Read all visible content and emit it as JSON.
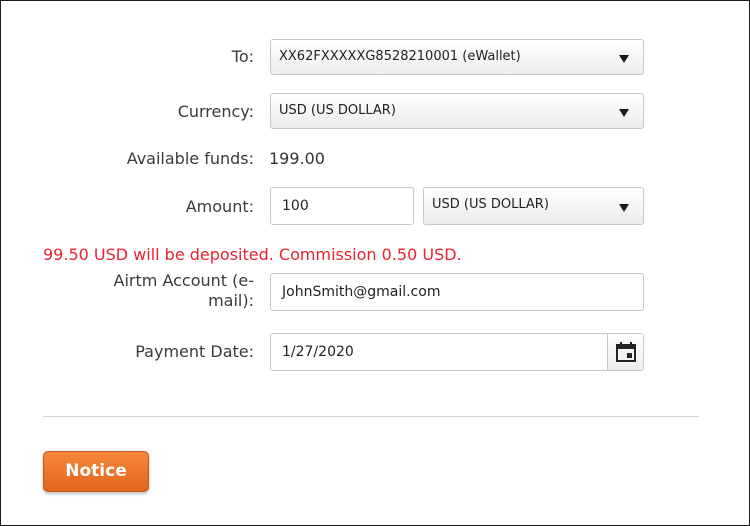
{
  "form": {
    "to": {
      "label": "To:",
      "value": "XX62FXXXXXG8528210001 (eWallet)"
    },
    "currency": {
      "label": "Currency:",
      "value": "USD (US DOLLAR)"
    },
    "available_funds": {
      "label": "Available funds:",
      "value": "199.00"
    },
    "amount": {
      "label": "Amount:",
      "value": "100",
      "currency_value": "USD (US DOLLAR)"
    },
    "deposit_notice": "99.50 USD will be deposited. Commission 0.50 USD.",
    "airtm_account": {
      "label_line1": "Airtm Account (e-",
      "label_line2": "mail):",
      "value": "JohnSmith@gmail.com"
    },
    "payment_date": {
      "label": "Payment Date:",
      "value": "1/27/2020"
    }
  },
  "actions": {
    "notice_label": "Notice"
  },
  "colors": {
    "warning": "#e8232f",
    "button": "#ee7526"
  },
  "icons": {
    "dropdown": "chevron-down-icon",
    "date_picker": "calendar-icon"
  }
}
